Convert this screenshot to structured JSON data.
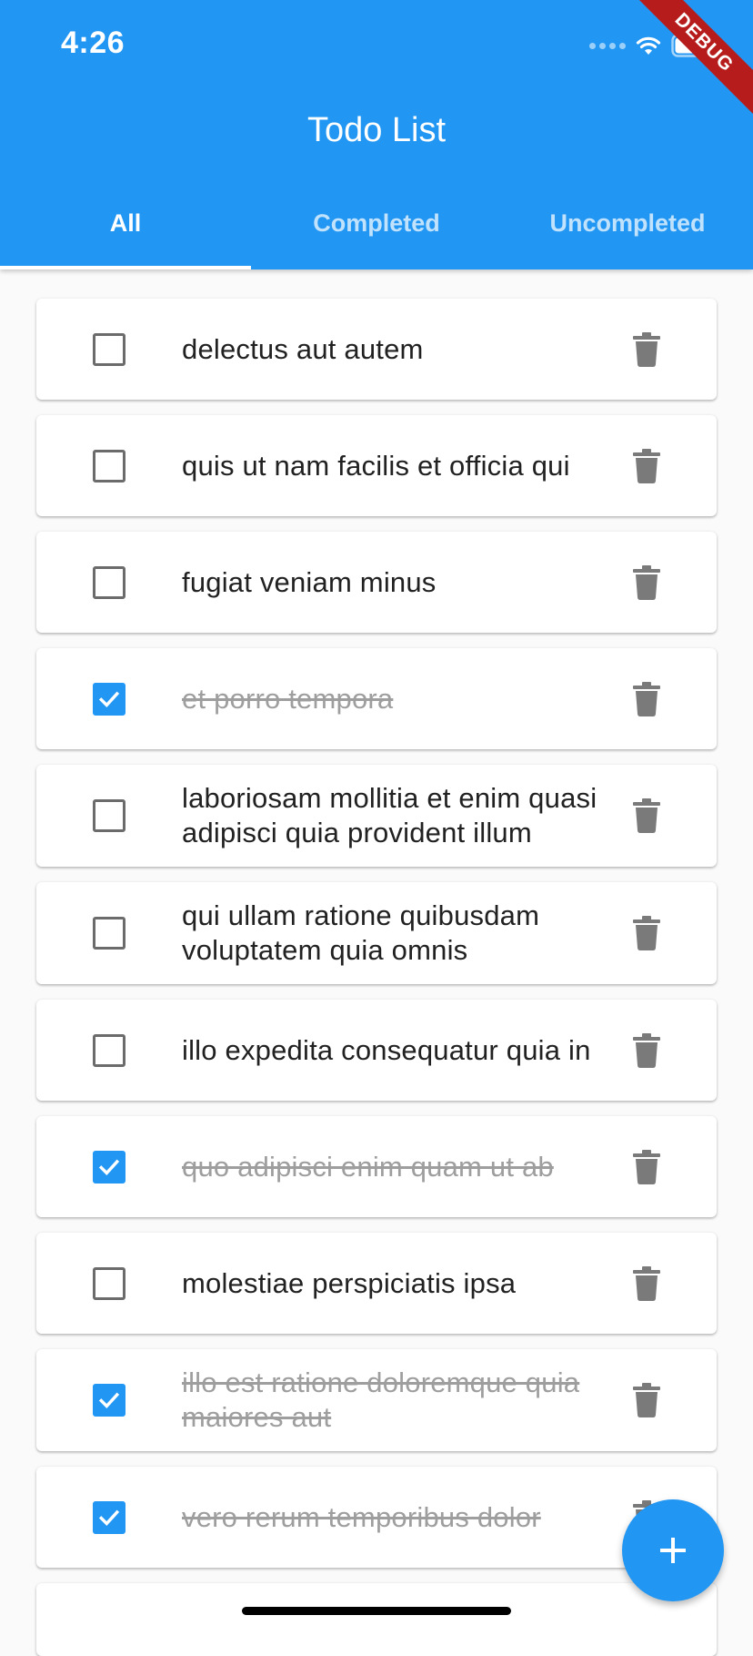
{
  "status_bar": {
    "time": "4:26",
    "icons": [
      "signal-icon",
      "wifi-icon",
      "battery-icon"
    ]
  },
  "debug_banner": "DEBUG",
  "appbar": {
    "title": "Todo List",
    "tabs": [
      {
        "label": "All",
        "active": true
      },
      {
        "label": "Completed",
        "active": false
      },
      {
        "label": "Uncompleted",
        "active": false
      }
    ]
  },
  "todos": [
    {
      "text": "delectus aut autem",
      "completed": false
    },
    {
      "text": "quis ut nam facilis et officia qui",
      "completed": false
    },
    {
      "text": "fugiat veniam minus",
      "completed": false
    },
    {
      "text": "et porro tempora",
      "completed": true
    },
    {
      "text": "laboriosam mollitia et enim quasi adipisci quia provident illum",
      "completed": false
    },
    {
      "text": "qui ullam ratione quibusdam voluptatem quia omnis",
      "completed": false
    },
    {
      "text": "illo expedita consequatur quia in",
      "completed": false
    },
    {
      "text": "quo adipisci enim quam ut ab",
      "completed": true
    },
    {
      "text": "molestiae perspiciatis ipsa",
      "completed": false
    },
    {
      "text": "illo est ratione doloremque quia maiores aut",
      "completed": true
    },
    {
      "text": "vero rerum temporibus dolor",
      "completed": true
    }
  ],
  "fab": {
    "icon": "plus-icon"
  },
  "colors": {
    "primary": "#2196F3",
    "text": "#212121",
    "completed_text": "#9e9e9e",
    "icon_gray": "#7a7a7a",
    "background": "#fafafa"
  }
}
